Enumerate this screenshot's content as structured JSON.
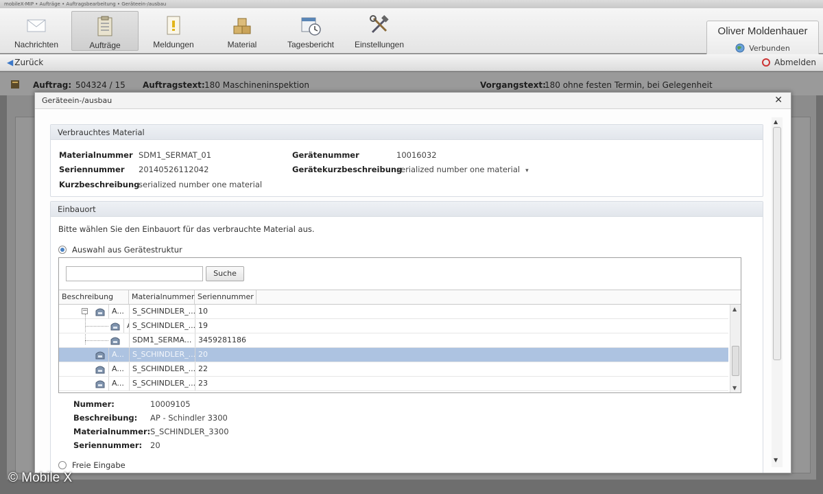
{
  "window_title": "mobileX-MIP • Aufträge • Auftragsbearbeitung • Geräteein-/ausbau",
  "ribbon": {
    "items": [
      {
        "label": "Nachrichten",
        "icon": "envelope-icon"
      },
      {
        "label": "Aufträge",
        "icon": "clipboard-icon",
        "active": true
      },
      {
        "label": "Meldungen",
        "icon": "notice-icon"
      },
      {
        "label": "Material",
        "icon": "boxes-icon"
      },
      {
        "label": "Tagesbericht",
        "icon": "calendar-clock-icon"
      },
      {
        "label": "Einstellungen",
        "icon": "tools-icon"
      }
    ],
    "user": {
      "name": "Oliver Moldenhauer",
      "status": "Verbunden"
    }
  },
  "navbar": {
    "back_label": "Zurück",
    "logout_label": "Abmelden"
  },
  "info": {
    "auftrag_label": "Auftrag:",
    "auftrag_value": "504324 / 15",
    "auftragstext_label": "Auftragstext:",
    "auftragstext_value": "180 Maschineninspektion",
    "vorgangstext_label": "Vorgangstext:",
    "vorgangstext_value": "180 ohne festen Termin, bei Gelegenheit"
  },
  "dialog": {
    "title": "Geräteein-/ausbau",
    "material_group": {
      "title": "Verbrauchtes Material",
      "materialnummer_label": "Materialnummer",
      "materialnummer_value": "SDM1_SERMAT_01",
      "seriennummer_label": "Seriennummer",
      "seriennummer_value": "20140526112042",
      "kurzbeschreibung_label": "Kurzbeschreibung",
      "kurzbeschreibung_value": "serialized number one material",
      "geraetenummer_label": "Gerätenummer",
      "geraetenummer_value": "10016032",
      "geraetekurz_label": "Gerätekurzbeschreibung",
      "geraetekurz_value": "serialized number one material"
    },
    "einbau_group": {
      "title": "Einbauort",
      "instruction": "Bitte wählen Sie den Einbauort für das verbrauchte Material aus.",
      "option_tree": "Auswahl aus Gerätestruktur",
      "option_free": "Freie Eingabe",
      "search_placeholder": "",
      "search_button": "Suche",
      "columns": [
        "Beschreibung",
        "Materialnummer",
        "Seriennummer"
      ],
      "rows": [
        {
          "desc": "A...",
          "mat": "S_SCHINDLER_...",
          "ser": "10",
          "level": 0,
          "expander": "−"
        },
        {
          "desc": "A...",
          "mat": "S_SCHINDLER_...",
          "ser": "19",
          "level": 1
        },
        {
          "desc": "",
          "mat": "SDM1_SERMA...",
          "ser": "3459281186",
          "level": 1
        },
        {
          "desc": "A...",
          "mat": "S_SCHINDLER_...",
          "ser": "20",
          "level": -1,
          "selected": true
        },
        {
          "desc": "A...",
          "mat": "S_SCHINDLER_...",
          "ser": "22",
          "level": -1
        },
        {
          "desc": "A...",
          "mat": "S_SCHINDLER_...",
          "ser": "23",
          "level": -1
        }
      ],
      "details": {
        "nummer_label": "Nummer:",
        "nummer_value": "10009105",
        "beschreibung_label": "Beschreibung:",
        "beschreibung_value": "AP - Schindler 3300",
        "materialnummer_label": "Materialnummer:",
        "materialnummer_value": "S_SCHINDLER_3300",
        "seriennummer_label": "Seriennummer:",
        "seriennummer_value": "20"
      }
    }
  },
  "copyright": "© Mobile X",
  "colors": {
    "selection": "#adc3e1",
    "accent": "#4b83c4",
    "ribbon_bg": "#eeeeee"
  }
}
